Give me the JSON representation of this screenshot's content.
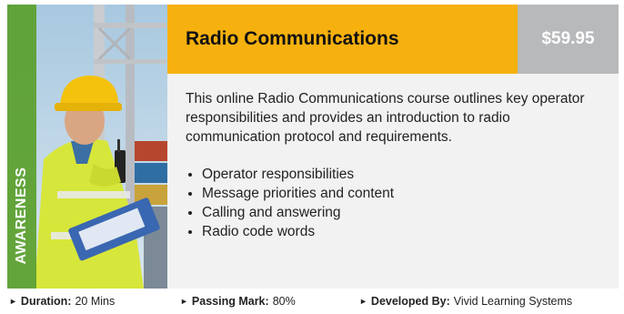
{
  "course": {
    "title": "Radio Communications",
    "price": "$59.95",
    "category": "AWARENESS",
    "description": "This online Radio Communications course outlines key operator responsibilities and provides an introduction to radio communication protocol and requirements.",
    "topics": [
      "Operator responsibilities",
      "Message priorities and content",
      "Calling and answering",
      "Radio code words"
    ]
  },
  "footer": {
    "duration_label": "Duration:",
    "duration_value": "20 Mins",
    "passing_label": "Passing Mark:",
    "passing_value": "80%",
    "developer_label": "Developed By:",
    "developer_value": "Vivid Learning Systems"
  },
  "colors": {
    "title_bar": "#f6b10f",
    "price_bar": "#b7b9bb",
    "category_badge": "#5aa02c",
    "card_background": "#f2f2f2"
  },
  "icons": {
    "footer_bullet": "triangle-right-icon",
    "list_bullet": "disc-bullet"
  }
}
